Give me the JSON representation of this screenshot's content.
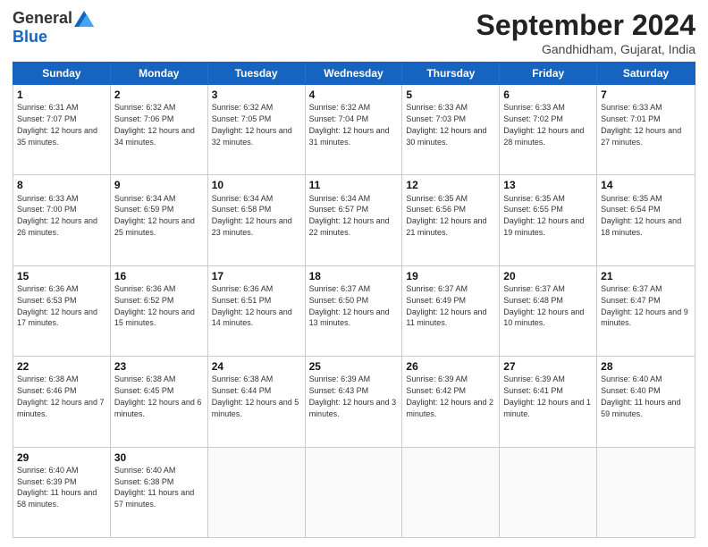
{
  "header": {
    "logo": {
      "general": "General",
      "blue": "Blue"
    },
    "title": "September 2024",
    "location": "Gandhidham, Gujarat, India"
  },
  "days": [
    "Sunday",
    "Monday",
    "Tuesday",
    "Wednesday",
    "Thursday",
    "Friday",
    "Saturday"
  ],
  "weeks": [
    [
      {
        "day": "1",
        "rise": "6:31 AM",
        "set": "7:07 PM",
        "daylight": "12 hours and 35 minutes."
      },
      {
        "day": "2",
        "rise": "6:32 AM",
        "set": "7:06 PM",
        "daylight": "12 hours and 34 minutes."
      },
      {
        "day": "3",
        "rise": "6:32 AM",
        "set": "7:05 PM",
        "daylight": "12 hours and 32 minutes."
      },
      {
        "day": "4",
        "rise": "6:32 AM",
        "set": "7:04 PM",
        "daylight": "12 hours and 31 minutes."
      },
      {
        "day": "5",
        "rise": "6:33 AM",
        "set": "7:03 PM",
        "daylight": "12 hours and 30 minutes."
      },
      {
        "day": "6",
        "rise": "6:33 AM",
        "set": "7:02 PM",
        "daylight": "12 hours and 28 minutes."
      },
      {
        "day": "7",
        "rise": "6:33 AM",
        "set": "7:01 PM",
        "daylight": "12 hours and 27 minutes."
      }
    ],
    [
      {
        "day": "8",
        "rise": "6:33 AM",
        "set": "7:00 PM",
        "daylight": "12 hours and 26 minutes."
      },
      {
        "day": "9",
        "rise": "6:34 AM",
        "set": "6:59 PM",
        "daylight": "12 hours and 25 minutes."
      },
      {
        "day": "10",
        "rise": "6:34 AM",
        "set": "6:58 PM",
        "daylight": "12 hours and 23 minutes."
      },
      {
        "day": "11",
        "rise": "6:34 AM",
        "set": "6:57 PM",
        "daylight": "12 hours and 22 minutes."
      },
      {
        "day": "12",
        "rise": "6:35 AM",
        "set": "6:56 PM",
        "daylight": "12 hours and 21 minutes."
      },
      {
        "day": "13",
        "rise": "6:35 AM",
        "set": "6:55 PM",
        "daylight": "12 hours and 19 minutes."
      },
      {
        "day": "14",
        "rise": "6:35 AM",
        "set": "6:54 PM",
        "daylight": "12 hours and 18 minutes."
      }
    ],
    [
      {
        "day": "15",
        "rise": "6:36 AM",
        "set": "6:53 PM",
        "daylight": "12 hours and 17 minutes."
      },
      {
        "day": "16",
        "rise": "6:36 AM",
        "set": "6:52 PM",
        "daylight": "12 hours and 15 minutes."
      },
      {
        "day": "17",
        "rise": "6:36 AM",
        "set": "6:51 PM",
        "daylight": "12 hours and 14 minutes."
      },
      {
        "day": "18",
        "rise": "6:37 AM",
        "set": "6:50 PM",
        "daylight": "12 hours and 13 minutes."
      },
      {
        "day": "19",
        "rise": "6:37 AM",
        "set": "6:49 PM",
        "daylight": "12 hours and 11 minutes."
      },
      {
        "day": "20",
        "rise": "6:37 AM",
        "set": "6:48 PM",
        "daylight": "12 hours and 10 minutes."
      },
      {
        "day": "21",
        "rise": "6:37 AM",
        "set": "6:47 PM",
        "daylight": "12 hours and 9 minutes."
      }
    ],
    [
      {
        "day": "22",
        "rise": "6:38 AM",
        "set": "6:46 PM",
        "daylight": "12 hours and 7 minutes."
      },
      {
        "day": "23",
        "rise": "6:38 AM",
        "set": "6:45 PM",
        "daylight": "12 hours and 6 minutes."
      },
      {
        "day": "24",
        "rise": "6:38 AM",
        "set": "6:44 PM",
        "daylight": "12 hours and 5 minutes."
      },
      {
        "day": "25",
        "rise": "6:39 AM",
        "set": "6:43 PM",
        "daylight": "12 hours and 3 minutes."
      },
      {
        "day": "26",
        "rise": "6:39 AM",
        "set": "6:42 PM",
        "daylight": "12 hours and 2 minutes."
      },
      {
        "day": "27",
        "rise": "6:39 AM",
        "set": "6:41 PM",
        "daylight": "12 hours and 1 minute."
      },
      {
        "day": "28",
        "rise": "6:40 AM",
        "set": "6:40 PM",
        "daylight": "11 hours and 59 minutes."
      }
    ],
    [
      {
        "day": "29",
        "rise": "6:40 AM",
        "set": "6:39 PM",
        "daylight": "11 hours and 58 minutes."
      },
      {
        "day": "30",
        "rise": "6:40 AM",
        "set": "6:38 PM",
        "daylight": "11 hours and 57 minutes."
      },
      null,
      null,
      null,
      null,
      null
    ]
  ]
}
